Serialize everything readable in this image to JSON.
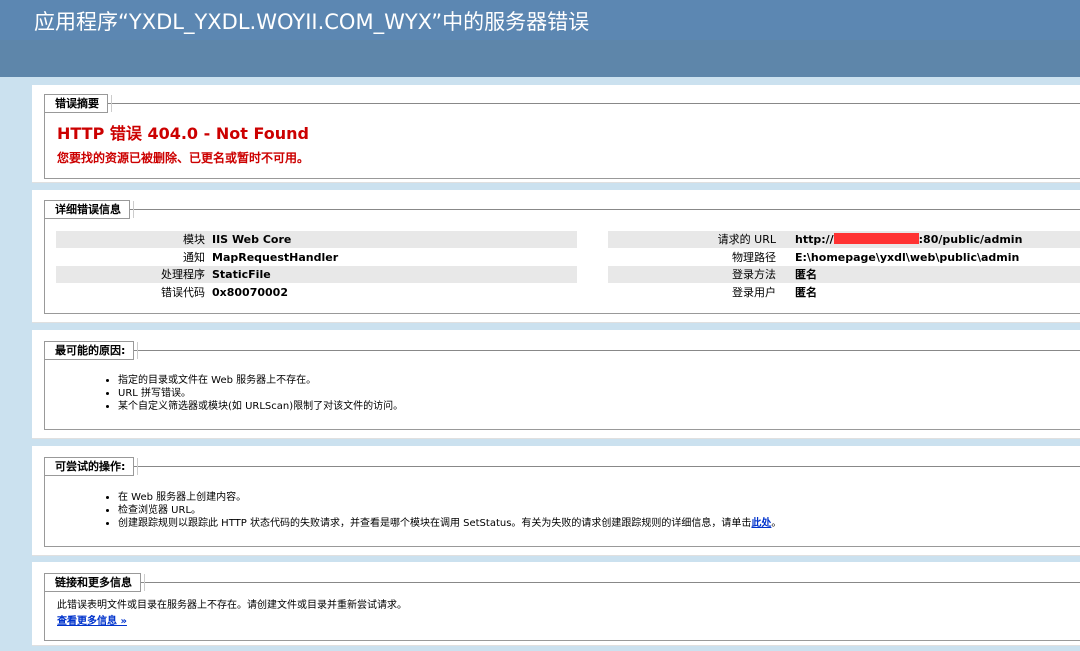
{
  "header": {
    "title": "应用程序“YXDL_YXDL.WOYII.COM_WYX”中的服务器错误"
  },
  "summary": {
    "legend": "错误摘要",
    "title": "HTTP 错误 404.0 - Not Found",
    "description": "您要找的资源已被删除、已更名或暂时不可用。"
  },
  "details": {
    "legend": "详细错误信息",
    "left": [
      {
        "label": "模块",
        "value": "IIS Web Core"
      },
      {
        "label": "通知",
        "value": "MapRequestHandler"
      },
      {
        "label": "处理程序",
        "value": "StaticFile"
      },
      {
        "label": "错误代码",
        "value": "0x80070002"
      }
    ],
    "right": [
      {
        "label": "请求的 URL",
        "value_prefix": "http://",
        "value_suffix": ":80/public/admin"
      },
      {
        "label": "物理路径",
        "value": "E:\\homepage\\yxdl\\web\\public\\admin"
      },
      {
        "label": "登录方法",
        "value": "匿名"
      },
      {
        "label": "登录用户",
        "value": "匿名"
      }
    ],
    "redaction_color": "#ff3333"
  },
  "causes": {
    "legend": "最可能的原因:",
    "items": [
      "指定的目录或文件在 Web 服务器上不存在。",
      "URL 拼写错误。",
      "某个自定义筛选器或模块(如 URLScan)限制了对该文件的访问。"
    ]
  },
  "actions": {
    "legend": "可尝试的操作:",
    "items": [
      "在 Web 服务器上创建内容。",
      "检查浏览器 URL。"
    ],
    "item3_text": "创建跟踪规则以跟踪此 HTTP 状态代码的失败请求，并查看是哪个模块在调用 SetStatus。有关为失败的请求创建跟踪规则的详细信息，请单击",
    "item3_link": "此处",
    "item3_end": "。"
  },
  "links": {
    "legend": "链接和更多信息",
    "text": "此错误表明文件或目录在服务器上不存在。请创建文件或目录并重新尝试请求。",
    "more": "查看更多信息 »"
  },
  "colors": {
    "header_bg": "#5c87b2",
    "page_bg": "#cbe1ef",
    "error_red": "#cc0000",
    "link_blue": "#0033cc"
  }
}
